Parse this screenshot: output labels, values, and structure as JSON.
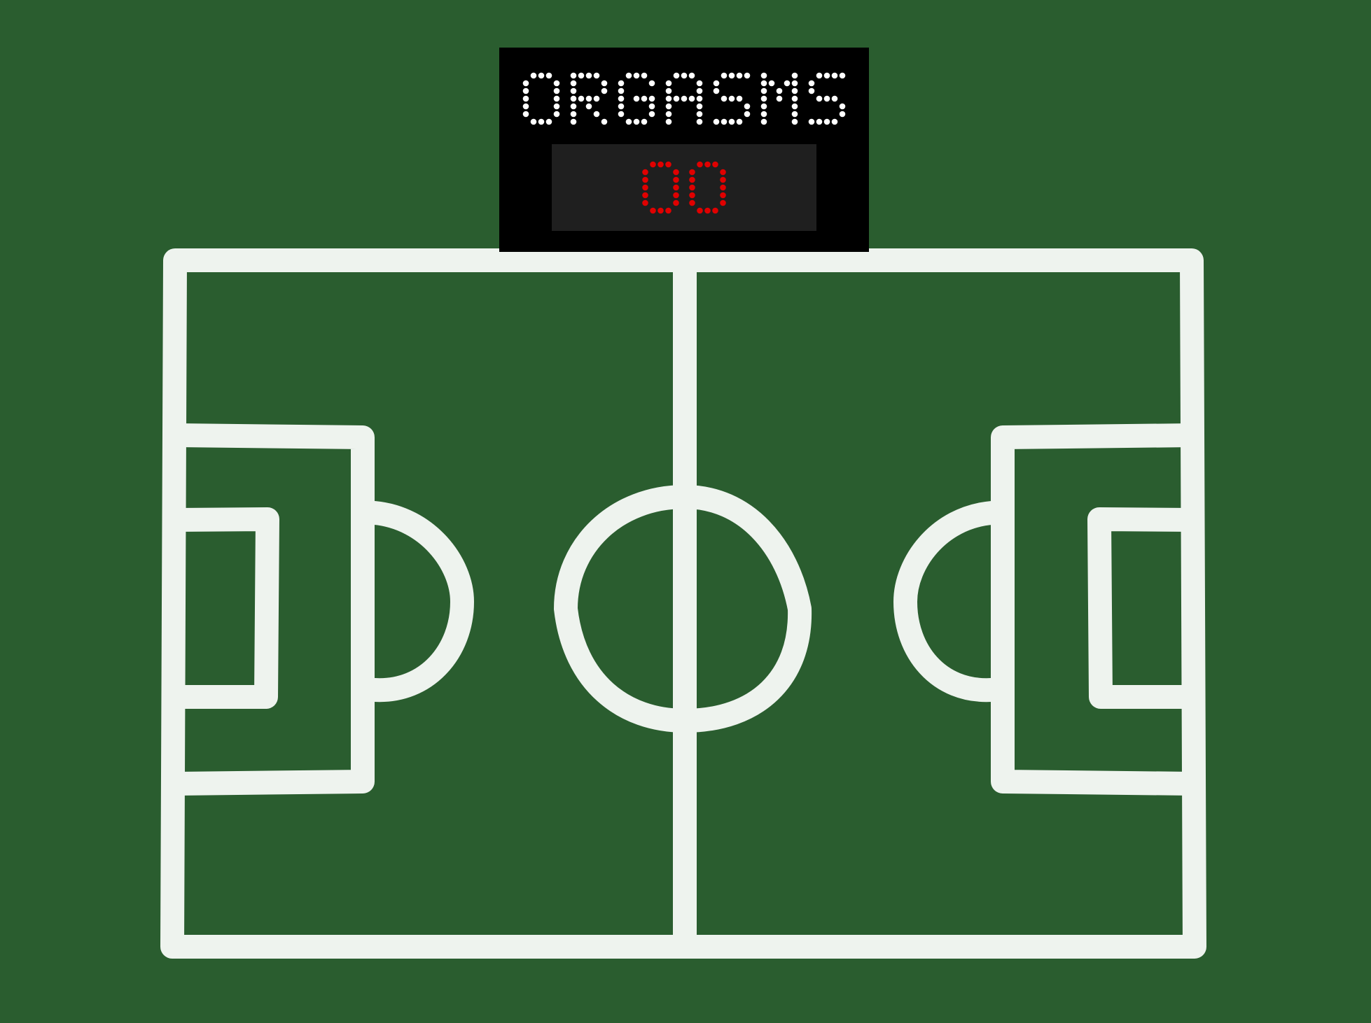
{
  "scoreboard": {
    "label": "ORGASMS",
    "score": "00",
    "label_color": "#ffffff",
    "score_color": "#e00000",
    "board_color": "#000000",
    "panel_color": "#1f1f1f"
  },
  "field": {
    "grass_color": "#2a5d2f",
    "line_color": "#eef3ee"
  }
}
